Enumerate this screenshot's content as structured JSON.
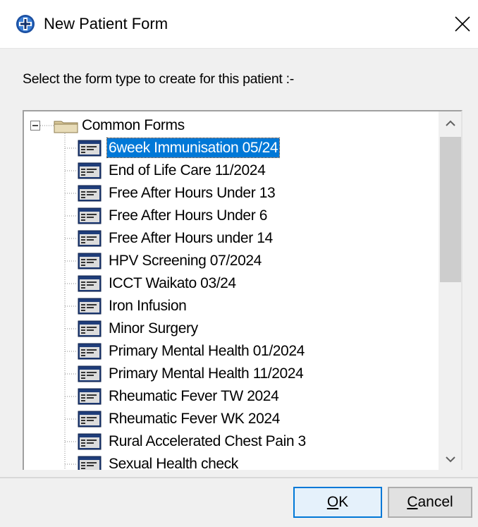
{
  "window": {
    "title": "New Patient Form",
    "app_icon": "medtech-cross-icon",
    "close_icon": "close-icon"
  },
  "prompt": "Select the form type to create for this patient :-",
  "tree": {
    "root": {
      "label": "Common Forms",
      "expanded": true,
      "icon": "folder-icon",
      "expander_icon": "minus-box-icon"
    },
    "items": [
      {
        "label": "6week Immunisation 05/24",
        "selected": true
      },
      {
        "label": "End of Life Care 11/2024"
      },
      {
        "label": "Free After Hours Under 13"
      },
      {
        "label": "Free After Hours Under 6"
      },
      {
        "label": "Free After Hours under 14"
      },
      {
        "label": "HPV Screening 07/2024"
      },
      {
        "label": "ICCT Waikato 03/24"
      },
      {
        "label": "Iron Infusion"
      },
      {
        "label": "Minor Surgery"
      },
      {
        "label": "Primary Mental Health 01/2024"
      },
      {
        "label": "Primary Mental Health 11/2024"
      },
      {
        "label": "Rheumatic Fever TW 2024"
      },
      {
        "label": "Rheumatic Fever WK 2024"
      },
      {
        "label": "Rural Accelerated Chest Pain 3"
      },
      {
        "label": "Sexual Health check"
      }
    ],
    "item_icon": "form-icon"
  },
  "scrollbar": {
    "up_icon": "chevron-up-icon",
    "down_icon": "chevron-down-icon"
  },
  "buttons": {
    "ok": {
      "mnemonic": "O",
      "rest": "K"
    },
    "cancel": {
      "mnemonic": "C",
      "rest": "ancel"
    }
  },
  "colors": {
    "selection": "#0078d7",
    "dialog_bg": "#f0f0f0",
    "app_icon_blue": "#1c4fa0"
  }
}
